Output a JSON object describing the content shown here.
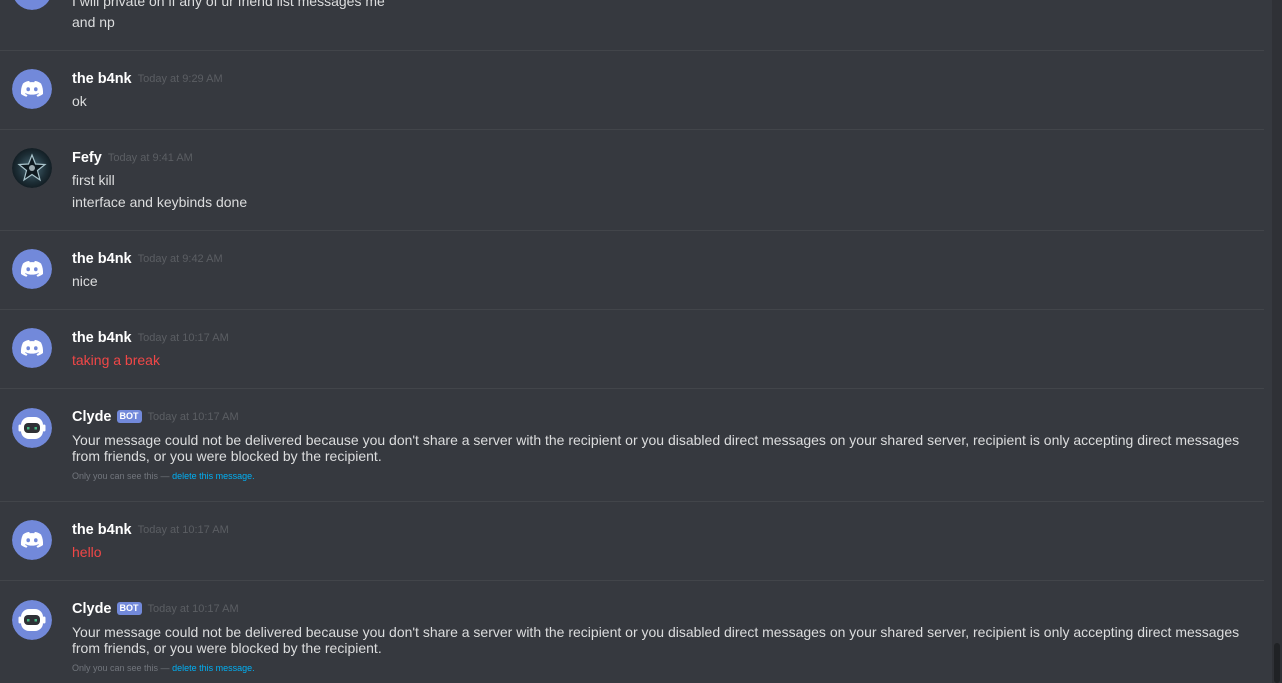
{
  "messages": {
    "partial": {
      "line_1": "I will private on if any of ur friend list messages me",
      "line_2": "and np"
    },
    "group_1": {
      "username": "the b4nk",
      "timestamp": "Today at 9:29 AM",
      "line_1": "ok"
    },
    "group_2": {
      "username": "Fefy",
      "timestamp": "Today at 9:41 AM",
      "line_1": "first kill",
      "line_2": "interface and keybinds done"
    },
    "group_3": {
      "username": "the b4nk",
      "timestamp": "Today at 9:42 AM",
      "line_1": "nice"
    },
    "group_4": {
      "username": "the b4nk",
      "timestamp": "Today at 10:17 AM",
      "line_1": "taking a break"
    },
    "group_5": {
      "username": "Clyde",
      "bot_tag": "BOT",
      "timestamp": "Today at 10:17 AM",
      "text": "Your message could not be delivered because you don't share a server with the recipient or you disabled direct messages on your shared server, recipient is only accepting direct messages from friends, or you were blocked by the recipient.",
      "note": "Only you can see this —",
      "delete_link": "delete this message."
    },
    "group_6": {
      "username": "the b4nk",
      "timestamp": "Today at 10:17 AM",
      "line_1": "hello"
    },
    "group_7": {
      "username": "Clyde",
      "bot_tag": "BOT",
      "timestamp": "Today at 10:17 AM",
      "text": "Your message could not be delivered because you don't share a server with the recipient or you disabled direct messages on your shared server, recipient is only accepting direct messages from friends, or you were blocked by the recipient.",
      "note": "Only you can see this —",
      "delete_link": "delete this message."
    }
  },
  "icons": {
    "discord_avatar": "discord-logo-icon",
    "clyde_avatar": "clyde-robot-icon",
    "fefy_avatar": "star-avatar-icon"
  },
  "colors": {
    "background": "#36393f",
    "divider": "#42454a",
    "username": "#ffffff",
    "timestamp": "#5b5e63",
    "message_text": "#dcddde",
    "red_text": "#f04747",
    "blurple": "#7289da",
    "link": "#00b0f4"
  }
}
